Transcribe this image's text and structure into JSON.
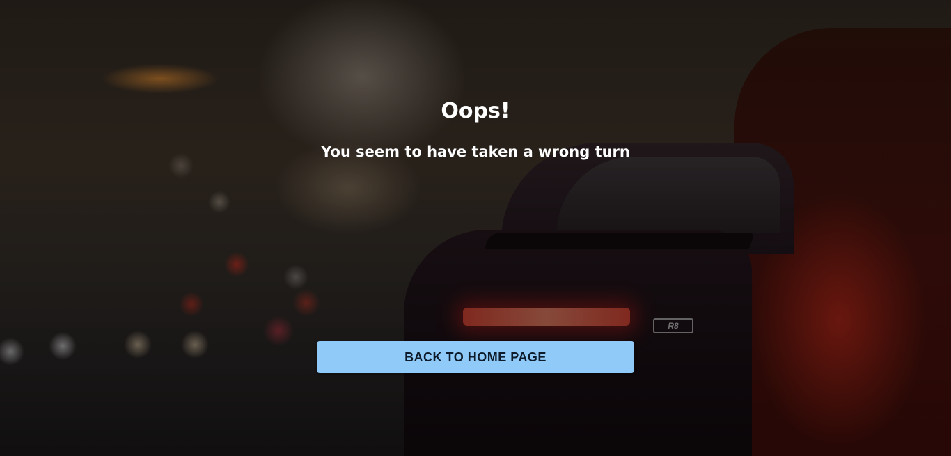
{
  "error_page": {
    "title": "Oops!",
    "message": "You seem to have taken a wrong turn",
    "home_button_label": "BACK TO HOME PAGE"
  },
  "background": {
    "badge_text": "R8"
  },
  "colors": {
    "button_background": "#90caf9",
    "button_text": "#0d1b2a",
    "heading_text": "#ffffff"
  }
}
